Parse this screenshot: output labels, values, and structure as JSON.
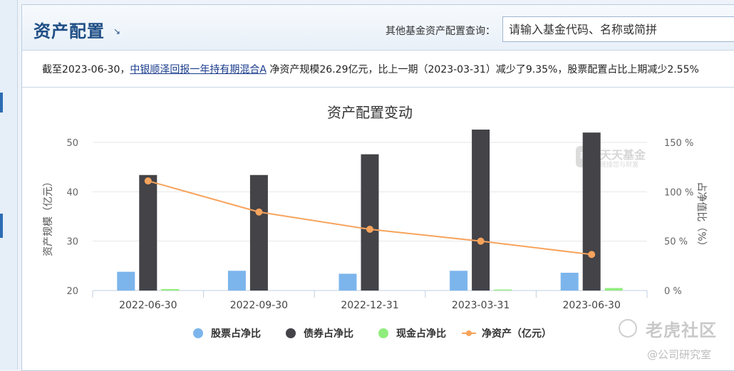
{
  "header": {
    "title": "资产配置",
    "query_label": "其他基金资产配置查询：",
    "query_placeholder": "请输入基金代码、名称或简拼"
  },
  "summary": {
    "prefix": "截至2023-06-30，",
    "fund_name": "中银顺泽回报一年持有期混合A",
    "suffix": " 净资产规模26.29亿元，比上一期（2023-03-31）减少了9.35%，股票配置占比上期减少2.55%"
  },
  "watermarks": {
    "logo_badge": "基金",
    "logo_name": "天天基金",
    "logo_tagline": "链接您与财富",
    "brand": "老虎社区",
    "account": "@公司研究室"
  },
  "chart_data": {
    "type": "bar",
    "title": "资产配置变动",
    "categories": [
      "2022-06-30",
      "2022-09-30",
      "2022-12-31",
      "2023-03-31",
      "2023-06-30"
    ],
    "series": [
      {
        "name": "股票占净比",
        "type": "bar",
        "axis": "right",
        "color": "#7cb5ec",
        "values": [
          19,
          20,
          17,
          20,
          18
        ]
      },
      {
        "name": "债券占净比",
        "type": "bar",
        "axis": "right",
        "color": "#434348",
        "values": [
          117,
          117,
          138,
          163,
          160
        ]
      },
      {
        "name": "现金占净比",
        "type": "bar",
        "axis": "right",
        "color": "#90ed7d",
        "values": [
          1.5,
          0,
          0,
          1,
          2.5
        ]
      },
      {
        "name": "净资产（亿元）",
        "type": "line",
        "axis": "left",
        "color": "#f7a35c",
        "values": [
          42.2,
          35.9,
          32.4,
          30.0,
          27.3
        ]
      }
    ],
    "y_left": {
      "label": "资产规模（亿元）",
      "ticks": [
        "20",
        "30",
        "40",
        "50"
      ],
      "min": 20,
      "max": 50
    },
    "y_right": {
      "label": "占净值比（%）",
      "ticks": [
        "0 %",
        "50 %",
        "100 %",
        "150 %"
      ],
      "min": 0,
      "max": 150
    },
    "grid": true,
    "legend": "bottom"
  }
}
